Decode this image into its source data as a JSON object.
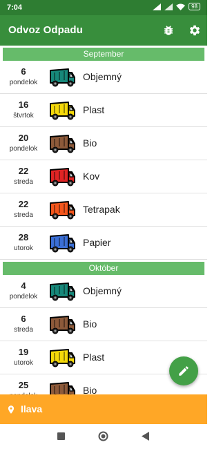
{
  "status_bar": {
    "time": "7:04",
    "battery": "98"
  },
  "app_bar": {
    "title": "Odvoz Odpadu",
    "actions": [
      "bug-icon",
      "settings-icon"
    ]
  },
  "sections": [
    {
      "month": "September",
      "entries": [
        {
          "day": "6",
          "weekday": "pondelok",
          "waste": "Objemný",
          "color": "#17887a"
        },
        {
          "day": "16",
          "weekday": "štvrtok",
          "waste": "Plast",
          "color": "#f5d90a"
        },
        {
          "day": "20",
          "weekday": "pondelok",
          "waste": "Bio",
          "color": "#8d5a3a"
        },
        {
          "day": "22",
          "weekday": "streda",
          "waste": "Kov",
          "color": "#e02424"
        },
        {
          "day": "22",
          "weekday": "streda",
          "waste": "Tetrapak",
          "color": "#f4561c"
        },
        {
          "day": "28",
          "weekday": "utorok",
          "waste": "Papier",
          "color": "#3b6fd6"
        }
      ]
    },
    {
      "month": "Október",
      "entries": [
        {
          "day": "4",
          "weekday": "pondelok",
          "waste": "Objemný",
          "color": "#17887a"
        },
        {
          "day": "6",
          "weekday": "streda",
          "waste": "Bio",
          "color": "#8d5a3a"
        },
        {
          "day": "19",
          "weekday": "utorok",
          "waste": "Plast",
          "color": "#f5d90a"
        },
        {
          "day": "25",
          "weekday": "pondelok",
          "waste": "Bio",
          "color": "#8d5a3a"
        }
      ]
    }
  ],
  "fab": {
    "icon": "pencil-icon"
  },
  "location": {
    "city": "Ilava",
    "icon": "location-pin-icon"
  },
  "colors": {
    "status_bar": "#2e7d32",
    "app_bar": "#388e3c",
    "month_header": "#66bb6a",
    "fab": "#43a047",
    "location_bar": "#ffa726"
  }
}
